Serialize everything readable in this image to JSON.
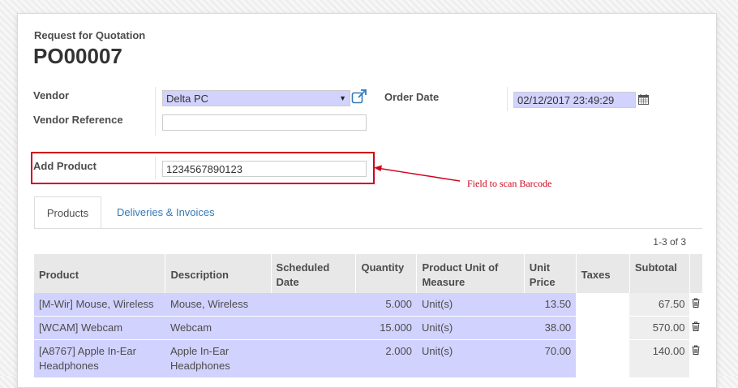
{
  "header": {
    "doc_kind": "Request for Quotation",
    "doc_name": "PO00007"
  },
  "form": {
    "vendor_label": "Vendor",
    "vendor_value": "Delta PC",
    "vendor_ref_label": "Vendor Reference",
    "vendor_ref_value": "",
    "order_date_label": "Order Date",
    "order_date_value": "02/12/2017 23:49:29",
    "add_product_label": "Add Product",
    "add_product_value": "1234567890123"
  },
  "annotation": {
    "text": "Field to scan Barcode",
    "color": "#d0021b"
  },
  "tabs": [
    {
      "label": "Products",
      "active": true
    },
    {
      "label": "Deliveries & Invoices",
      "active": false
    }
  ],
  "pager": "1-3 of 3",
  "table": {
    "columns": [
      "Product",
      "Description",
      "Scheduled Date",
      "Quantity",
      "Product Unit of Measure",
      "Unit Price",
      "Taxes",
      "Subtotal"
    ],
    "rows": [
      {
        "product": "[M-Wir] Mouse, Wireless",
        "description": "Mouse, Wireless",
        "scheduled_date": "",
        "quantity": "5.000",
        "uom": "Unit(s)",
        "unit_price": "13.50",
        "taxes": "",
        "subtotal": "67.50"
      },
      {
        "product": "[WCAM] Webcam",
        "description": "Webcam",
        "scheduled_date": "",
        "quantity": "15.000",
        "uom": "Unit(s)",
        "unit_price": "38.00",
        "taxes": "",
        "subtotal": "570.00"
      },
      {
        "product": "[A8767] Apple In-Ear Headphones",
        "description": "Apple In-Ear Headphones",
        "scheduled_date": "",
        "quantity": "2.000",
        "uom": "Unit(s)",
        "unit_price": "70.00",
        "taxes": "",
        "subtotal": "140.00"
      }
    ]
  },
  "icons": {
    "external_link": "external-link-icon",
    "calendar": "calendar-icon",
    "trash": "trash-icon",
    "dropdown": "caret-down-icon"
  },
  "colors": {
    "required_field": "#d2d2ff",
    "link": "#337ab7",
    "highlight": "#d0021b"
  }
}
